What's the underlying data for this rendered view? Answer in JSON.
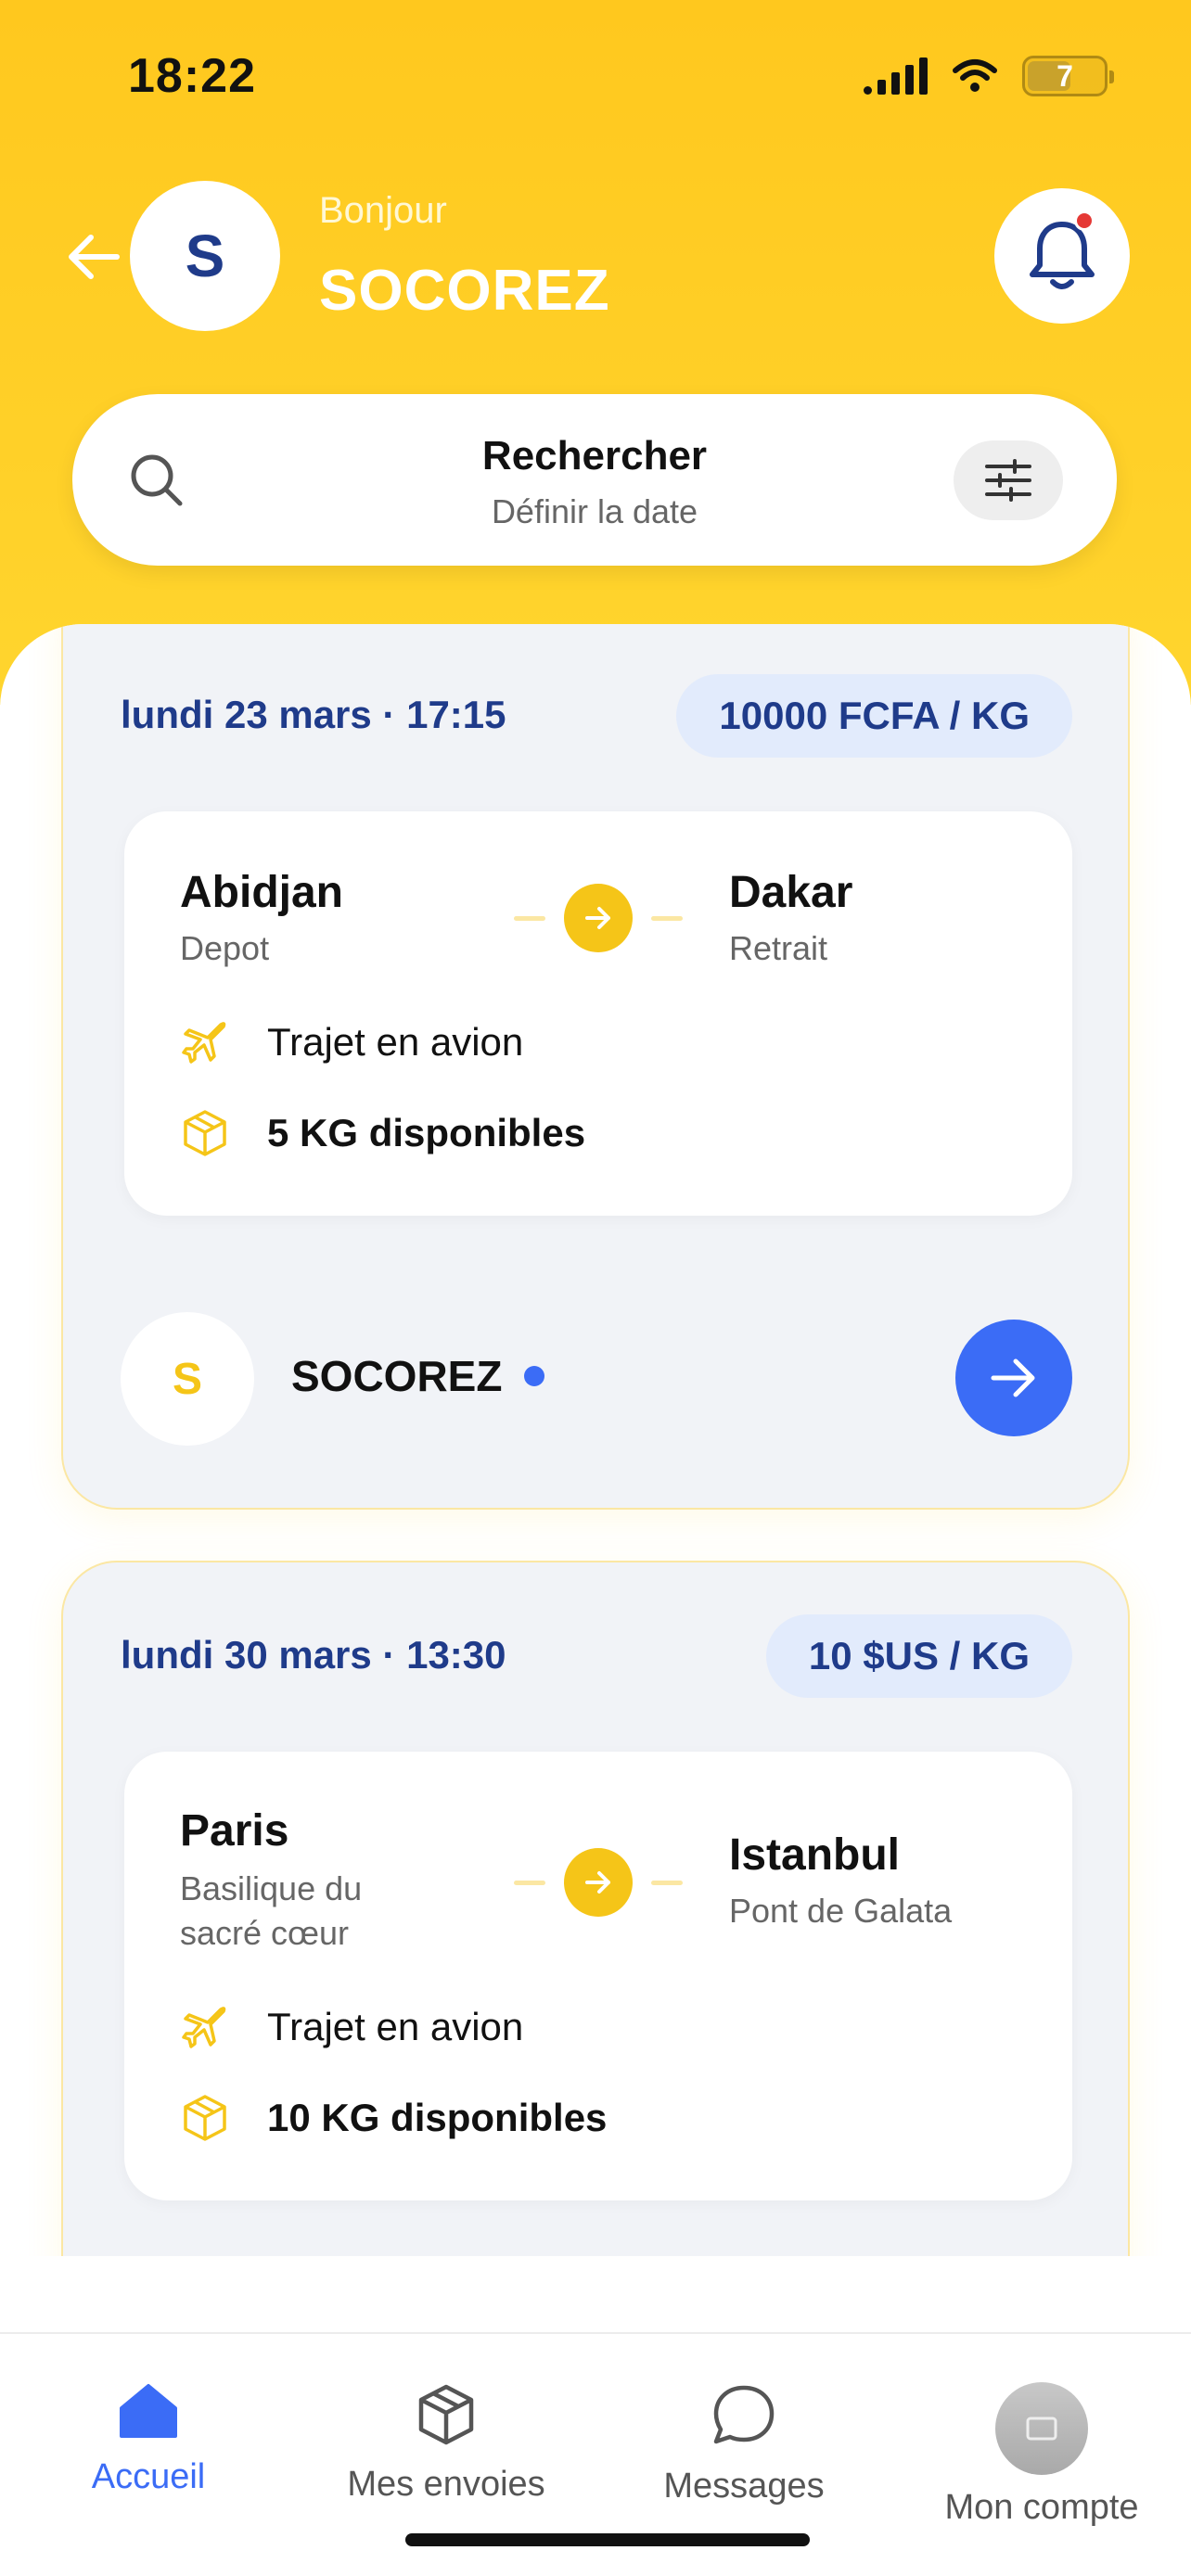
{
  "status_bar": {
    "time": "18:22",
    "battery": "7"
  },
  "header": {
    "avatar_initial": "S",
    "greeting": "Bonjour",
    "username": "SOCOREZ"
  },
  "search": {
    "title": "Rechercher",
    "subtitle": "Définir la date"
  },
  "trips": [
    {
      "date": "lundi 23 mars · 17:15",
      "price": "10000 FCFA / KG",
      "from_city": "Abidjan",
      "from_place": "Depot",
      "to_city": "Dakar",
      "to_place": "Retrait",
      "mode": "Trajet en avion",
      "capacity": "5 KG disponibles",
      "owner_initial": "S",
      "owner_name": "SOCOREZ"
    },
    {
      "date": "lundi 30 mars · 13:30",
      "price": "10 $US / KG",
      "from_city": "Paris",
      "from_place": "Basilique du sacré cœur",
      "to_city": "Istanbul",
      "to_place": "Pont de Galata",
      "mode": "Trajet en avion",
      "capacity": "10 KG disponibles"
    }
  ],
  "tabs": [
    {
      "label": "Accueil",
      "icon": "home-icon",
      "active": true
    },
    {
      "label": "Mes envoies",
      "icon": "package-icon"
    },
    {
      "label": "Messages",
      "icon": "chat-bubble-icon"
    },
    {
      "label": "Mon compte",
      "icon": "account-avatar"
    }
  ],
  "colors": {
    "header_yellow": "#FFC81E",
    "accent_blue": "#3B6CF6",
    "navy": "#1F3B8A",
    "icon_yellow": "#F5C518"
  }
}
